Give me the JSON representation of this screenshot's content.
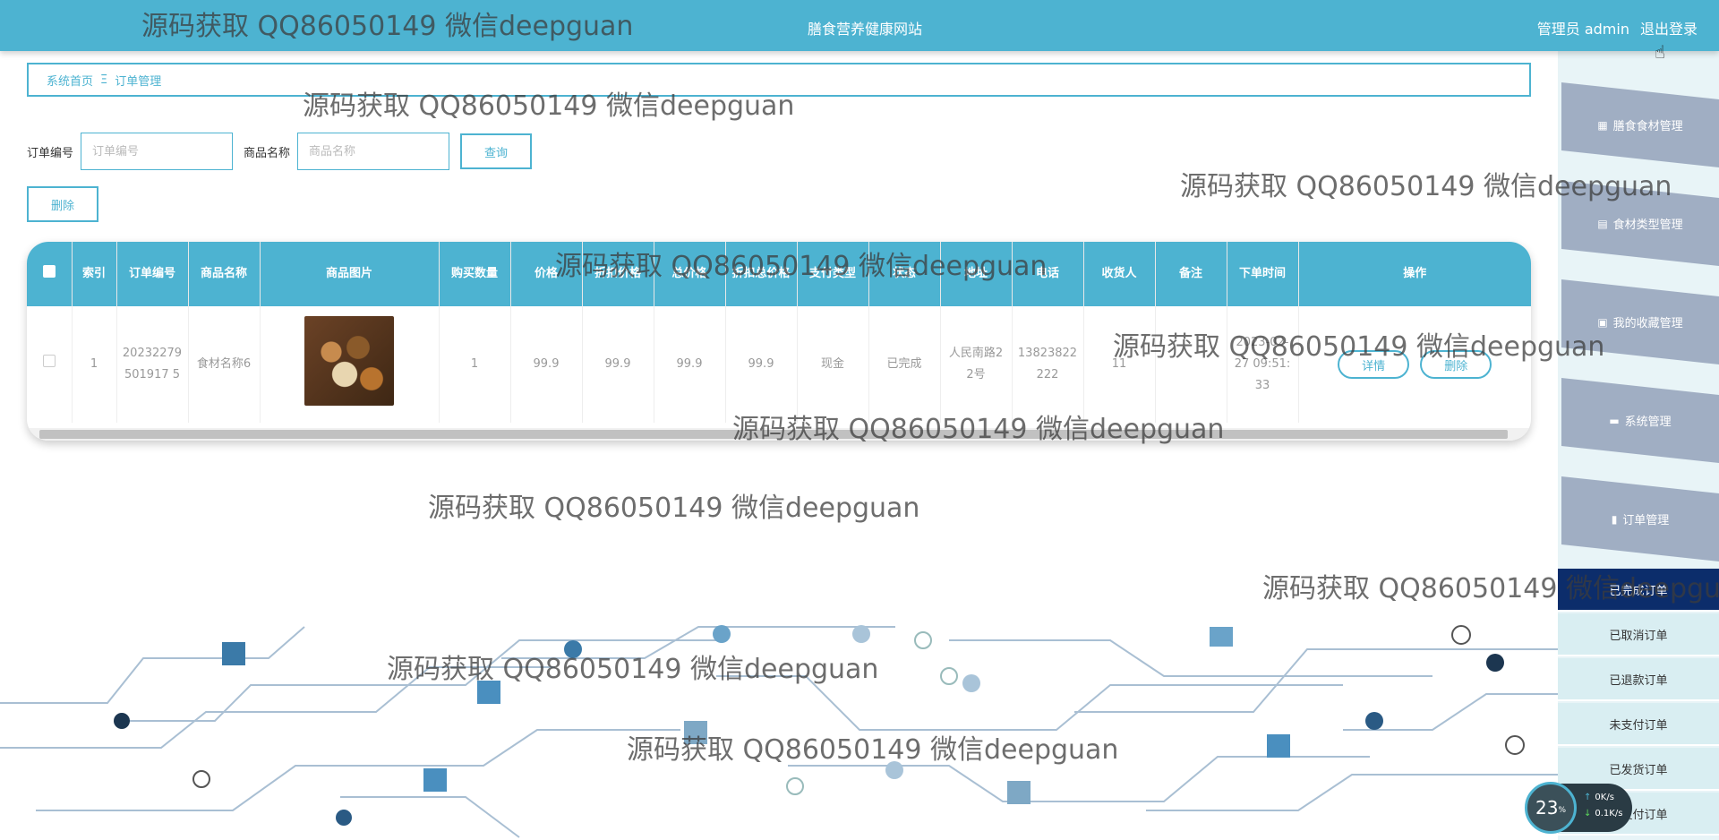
{
  "header": {
    "site_title": "膳食营养健康网站",
    "user_label": "管理员 admin",
    "logout_label": "退出登录"
  },
  "breadcrumb": {
    "home": "系统首页",
    "separator": "Ξ",
    "current": "订单管理"
  },
  "search": {
    "order_no_label": "订单编号",
    "order_no_placeholder": "订单编号",
    "product_name_label": "商品名称",
    "product_name_placeholder": "商品名称",
    "query_button": "查询"
  },
  "bulk_delete_button": "删除",
  "table": {
    "columns": [
      "",
      "索引",
      "订单编号",
      "商品名称",
      "商品图片",
      "购买数量",
      "价格",
      "折扣价格",
      "总价格",
      "折扣总价格",
      "支付类型",
      "状态",
      "地址",
      "电话",
      "收货人",
      "备注",
      "下单时间",
      "操作"
    ],
    "rows": [
      {
        "index": "1",
        "order_no": "20232279501917 5",
        "product_name": "食材名称6",
        "quantity": "1",
        "price": "99.9",
        "discount_price": "99.9",
        "total_price": "99.9",
        "discount_total": "99.9",
        "pay_type": "现金",
        "status": "已完成",
        "address": "人民南路22号",
        "phone": "13823822222",
        "receiver": "11",
        "note": "",
        "order_time": "2023-02-27 09:51:33",
        "detail_button": "详情",
        "delete_button": "删除"
      }
    ]
  },
  "sidebar": {
    "menu": [
      {
        "label": "膳食食材管理",
        "icon": "grid-icon"
      },
      {
        "label": "食材类型管理",
        "icon": "clipboard-icon"
      },
      {
        "label": "我的收藏管理",
        "icon": "briefcase-icon"
      },
      {
        "label": "系统管理",
        "icon": "monitor-icon"
      },
      {
        "label": "订单管理",
        "icon": "bar-chart-icon"
      }
    ],
    "order_submenu": [
      "已完成订单",
      "已取消订单",
      "已退款订单",
      "未支付订单",
      "已发货订单",
      "已支付订单"
    ],
    "active_submenu": "已完成订单"
  },
  "watermark": "源码获取 QQ86050149 微信deepguan",
  "net_widget": {
    "percent": "23",
    "percent_unit": "%",
    "up": "0",
    "up_unit": "K/s",
    "down": "0.1",
    "down_unit": "K/s"
  },
  "colors": {
    "primary": "#4db3d1",
    "sidebar_item": "#a0aec3",
    "active_submenu": "#0c2d6b"
  }
}
